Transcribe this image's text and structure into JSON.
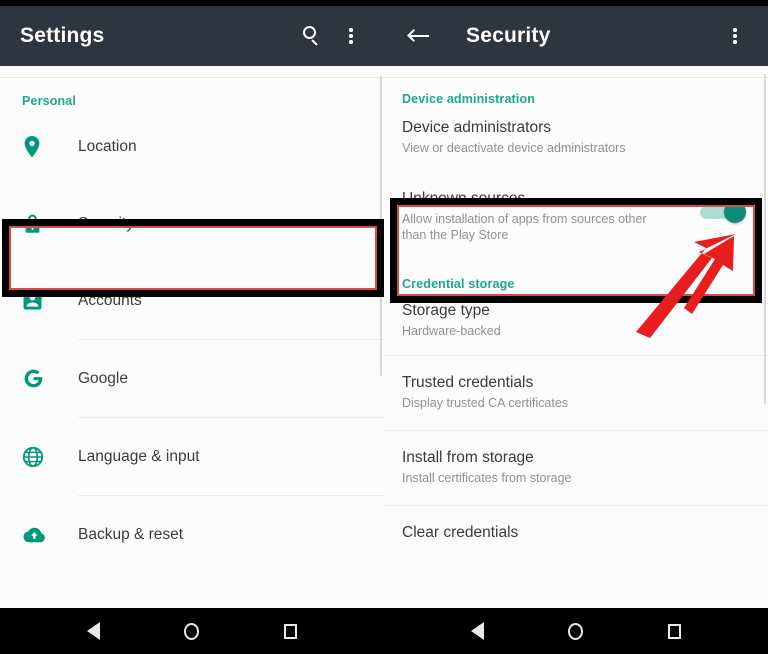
{
  "left_panel": {
    "appbar": {
      "title": "Settings",
      "search_icon": "search-icon",
      "overflow_icon": "overflow-menu-icon"
    },
    "section_header": "Personal",
    "items": [
      {
        "label": "Location",
        "icon": "location-pin-icon"
      },
      {
        "label": "Security",
        "icon": "lock-icon"
      },
      {
        "label": "Accounts",
        "icon": "account-box-icon"
      },
      {
        "label": "Google",
        "icon": "google-g-icon"
      },
      {
        "label": "Language & input",
        "icon": "globe-icon"
      },
      {
        "label": "Backup & reset",
        "icon": "cloud-upload-icon"
      }
    ]
  },
  "right_panel": {
    "appbar": {
      "back_icon": "back-arrow-icon",
      "title": "Security",
      "overflow_icon": "overflow-menu-icon"
    },
    "sections": [
      {
        "header": "Device administration",
        "items": [
          {
            "title": "Device administrators",
            "subtitle": "View or deactivate device administrators",
            "has_toggle": false
          },
          {
            "title": "Unknown sources",
            "subtitle": "Allow installation of apps from sources other than the Play Store",
            "has_toggle": true,
            "toggle_state": "on"
          }
        ]
      },
      {
        "header": "Credential storage",
        "items": [
          {
            "title": "Storage type",
            "subtitle": "Hardware-backed",
            "has_toggle": false
          },
          {
            "title": "Trusted credentials",
            "subtitle": "Display trusted CA certificates",
            "has_toggle": false
          },
          {
            "title": "Install from storage",
            "subtitle": "Install certificates from storage",
            "has_toggle": false
          },
          {
            "title": "Clear credentials",
            "subtitle": "",
            "has_toggle": false
          }
        ]
      }
    ]
  },
  "navbar": {
    "back_icon": "nav-back-icon",
    "home_icon": "nav-home-icon",
    "recents_icon": "nav-recents-icon"
  },
  "annotations": {
    "security_box": "highlight-box-security",
    "unknown_sources_box": "highlight-box-unknown-sources",
    "arrow": "pointer-arrow-to-toggle",
    "box_color": "#000000",
    "box_inner_color": "#d94a4a",
    "arrow_color": "#e81d1d"
  },
  "colors": {
    "appbar_bg": "#2b3640",
    "accent_teal": "#00987c",
    "section_header_teal": "#1ba98a",
    "toggle_on_thumb": "#0a8e77",
    "toggle_on_track": "#9fd8cd",
    "panel_bg": "#fcfcfc",
    "navbar_bg": "#000000"
  }
}
